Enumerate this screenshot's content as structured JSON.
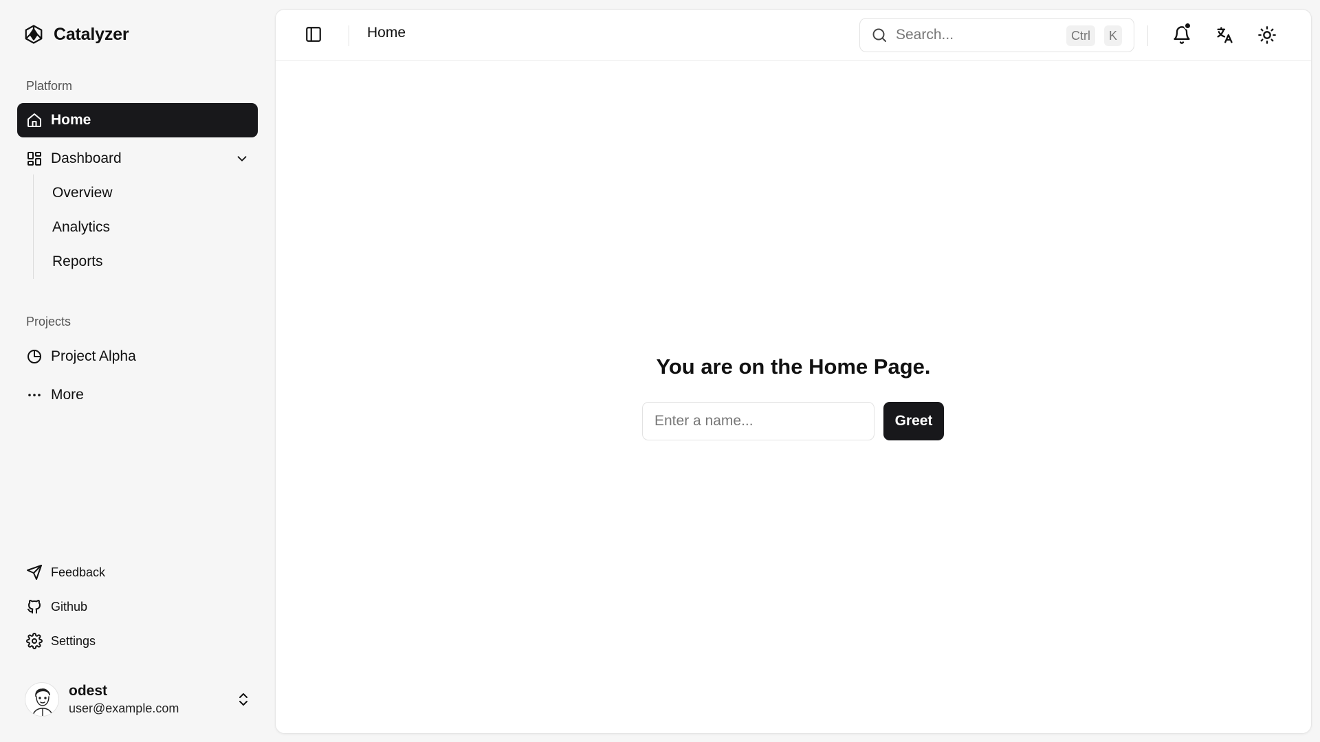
{
  "sidebar": {
    "brand": "Catalyzer",
    "platform_label": "Platform",
    "nav": {
      "home": "Home",
      "dashboard": "Dashboard",
      "sub": [
        "Overview",
        "Analytics",
        "Reports"
      ]
    },
    "projects_label": "Projects",
    "projects": {
      "alpha": "Project Alpha",
      "more": "More"
    },
    "footer": {
      "feedback": "Feedback",
      "github": "Github",
      "settings": "Settings"
    },
    "user": {
      "name": "odest",
      "email": "user@example.com"
    }
  },
  "topbar": {
    "breadcrumb": "Home",
    "search": {
      "placeholder": "Search...",
      "shortcut_mod": "Ctrl",
      "shortcut_key": "K"
    }
  },
  "main": {
    "title": "You are on the Home Page.",
    "name_input_placeholder": "Enter a name...",
    "greet_label": "Greet"
  },
  "colors": {
    "sidebar_bg": "#f6f6f6",
    "active_bg": "#18181b",
    "panel_bg": "#ffffff"
  }
}
